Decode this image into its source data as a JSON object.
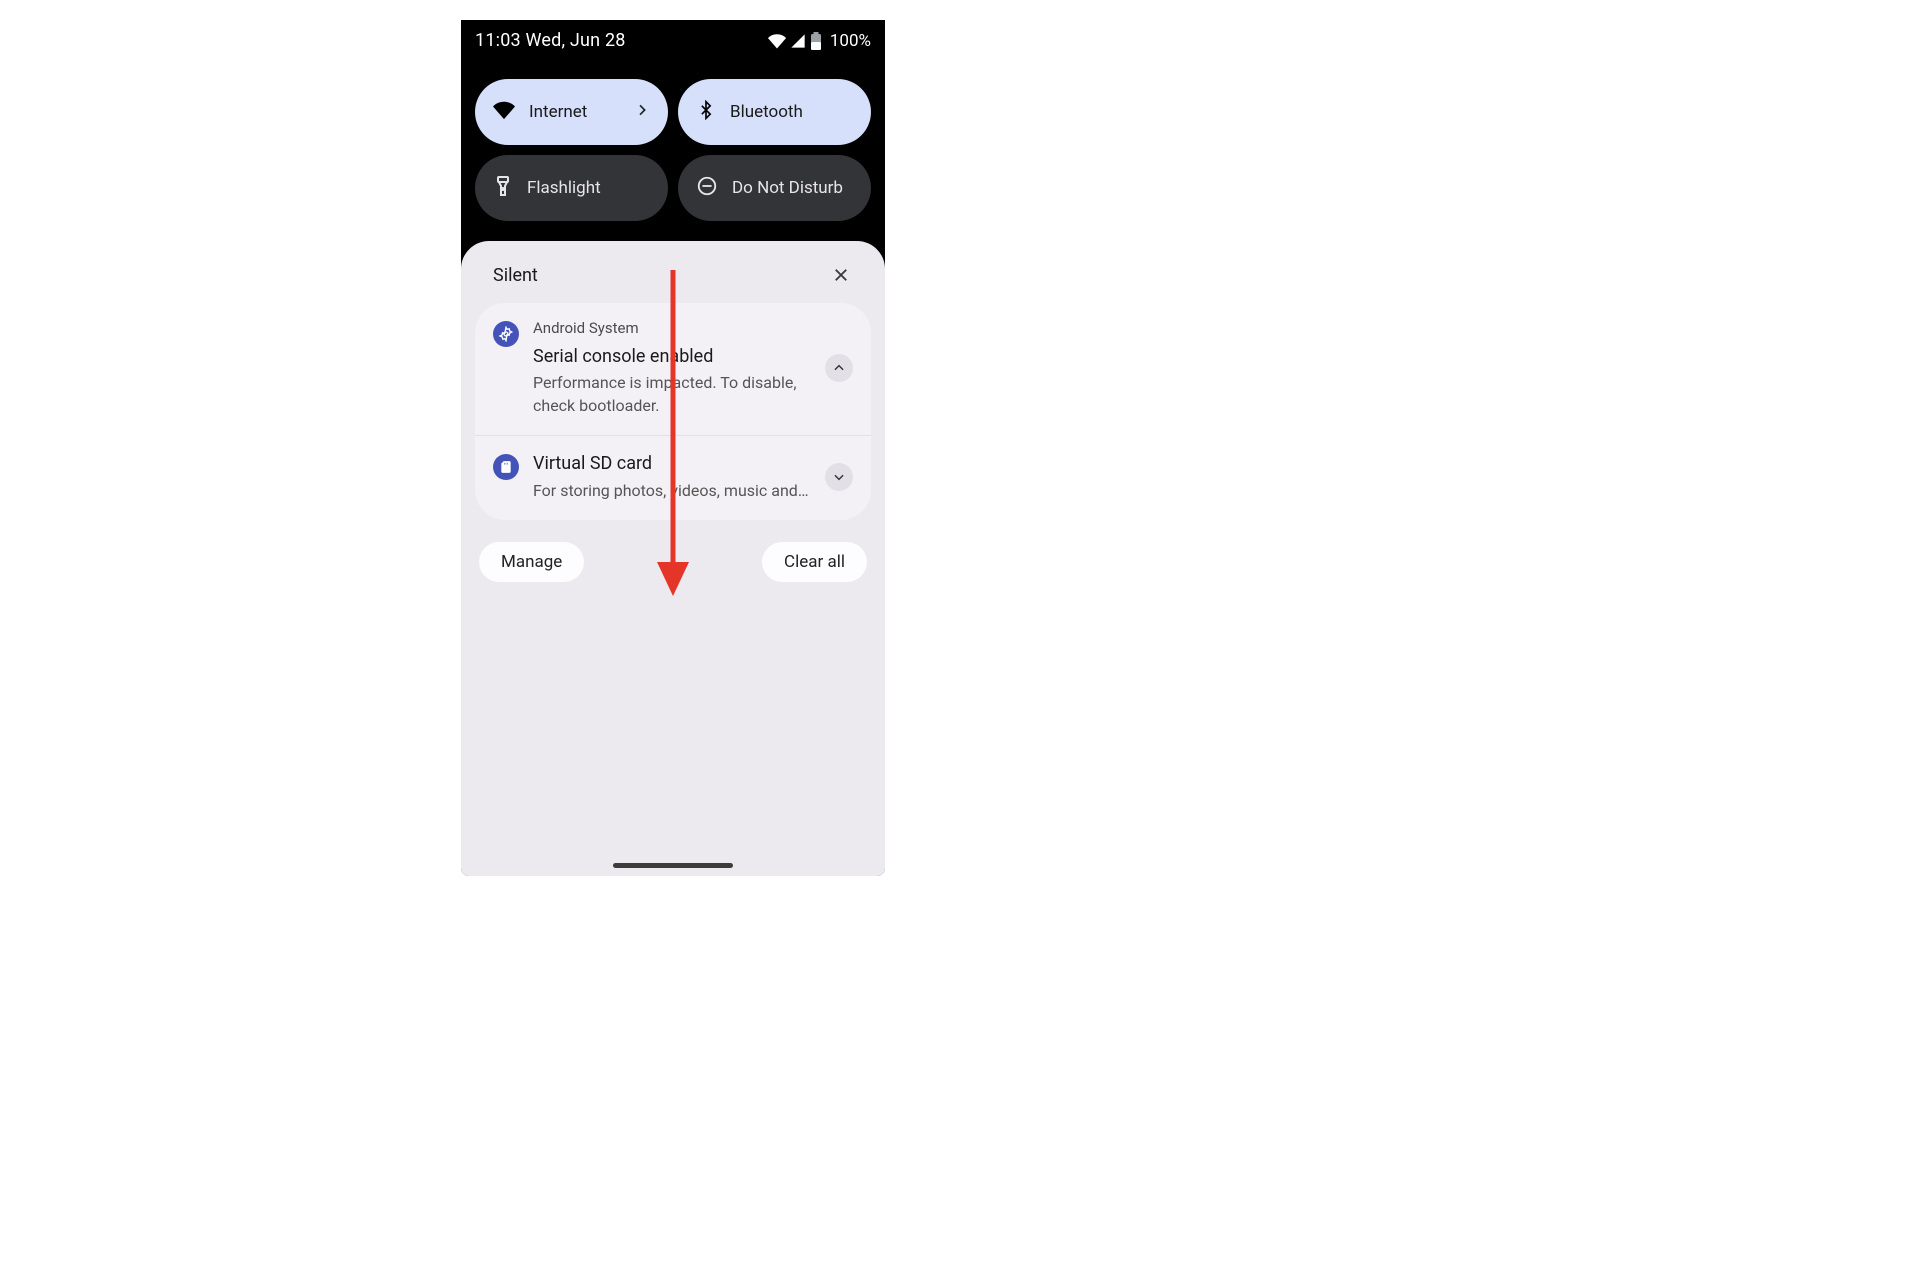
{
  "status": {
    "time_date": "11:03 Wed, Jun 28",
    "battery_text": "100%"
  },
  "tiles": {
    "internet": "Internet",
    "bluetooth": "Bluetooth",
    "flashlight": "Flashlight",
    "dnd": "Do Not Disturb"
  },
  "shade": {
    "section_label": "Silent",
    "manage_label": "Manage",
    "clear_label": "Clear all"
  },
  "notifications": [
    {
      "app": "Android System",
      "title": "Serial console enabled",
      "body": "Performance is impacted. To disable, check bootloader."
    },
    {
      "title": "Virtual SD card",
      "body": "For storing photos, videos, music and …"
    }
  ],
  "colors": {
    "accent_tile": "#d6e0fa",
    "off_tile": "#333437",
    "arrow": "#e53528"
  }
}
